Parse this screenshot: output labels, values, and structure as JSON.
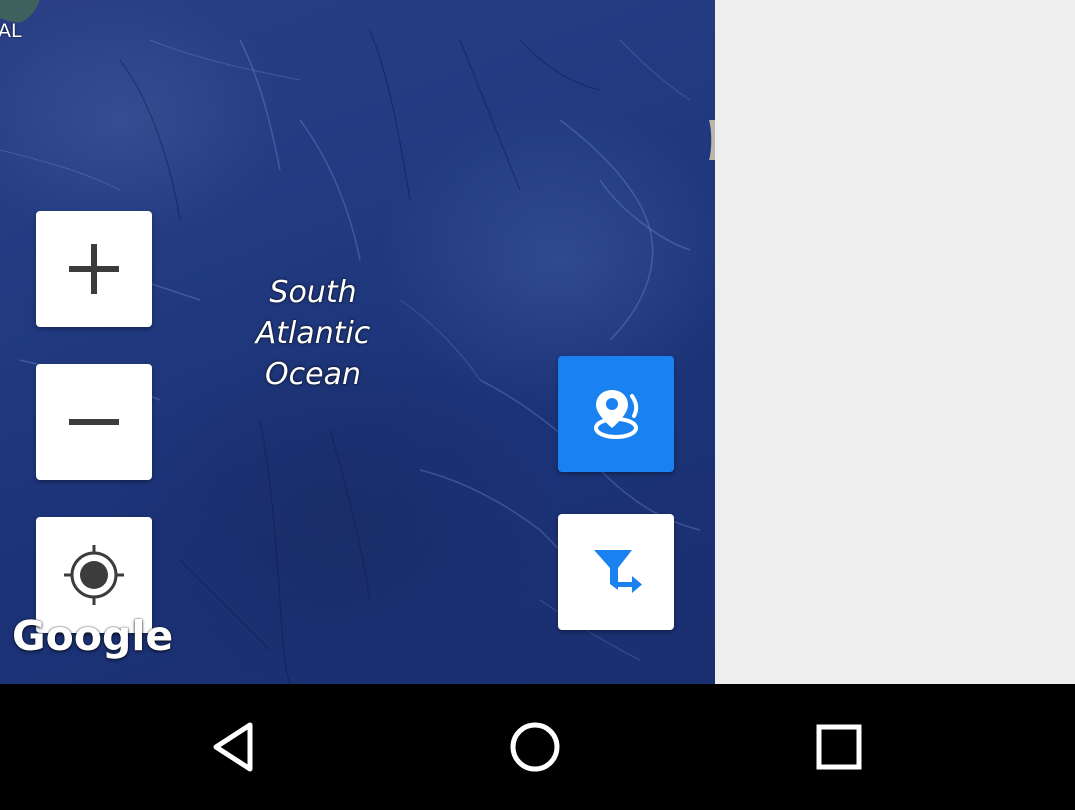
{
  "map": {
    "ocean_label_lines": [
      "South",
      "Atlantic",
      "Ocean"
    ],
    "corner_label": "AL",
    "attribution": "Google",
    "colors": {
      "ocean": "#213a80",
      "side_panel": "#eeeeee",
      "accent_blue": "#1a82f0"
    }
  },
  "controls": {
    "zoom_in": {
      "icon": "plus-icon"
    },
    "zoom_out": {
      "icon": "minus-icon"
    },
    "my_location": {
      "icon": "crosshair-target-icon"
    },
    "locations": {
      "icon": "location-pin-icon",
      "active": true
    },
    "filter": {
      "icon": "filter-arrow-icon"
    }
  },
  "navigation_bar": {
    "back": {
      "icon": "back-triangle-icon"
    },
    "home": {
      "icon": "home-circle-icon"
    },
    "recents": {
      "icon": "recents-square-icon"
    }
  }
}
